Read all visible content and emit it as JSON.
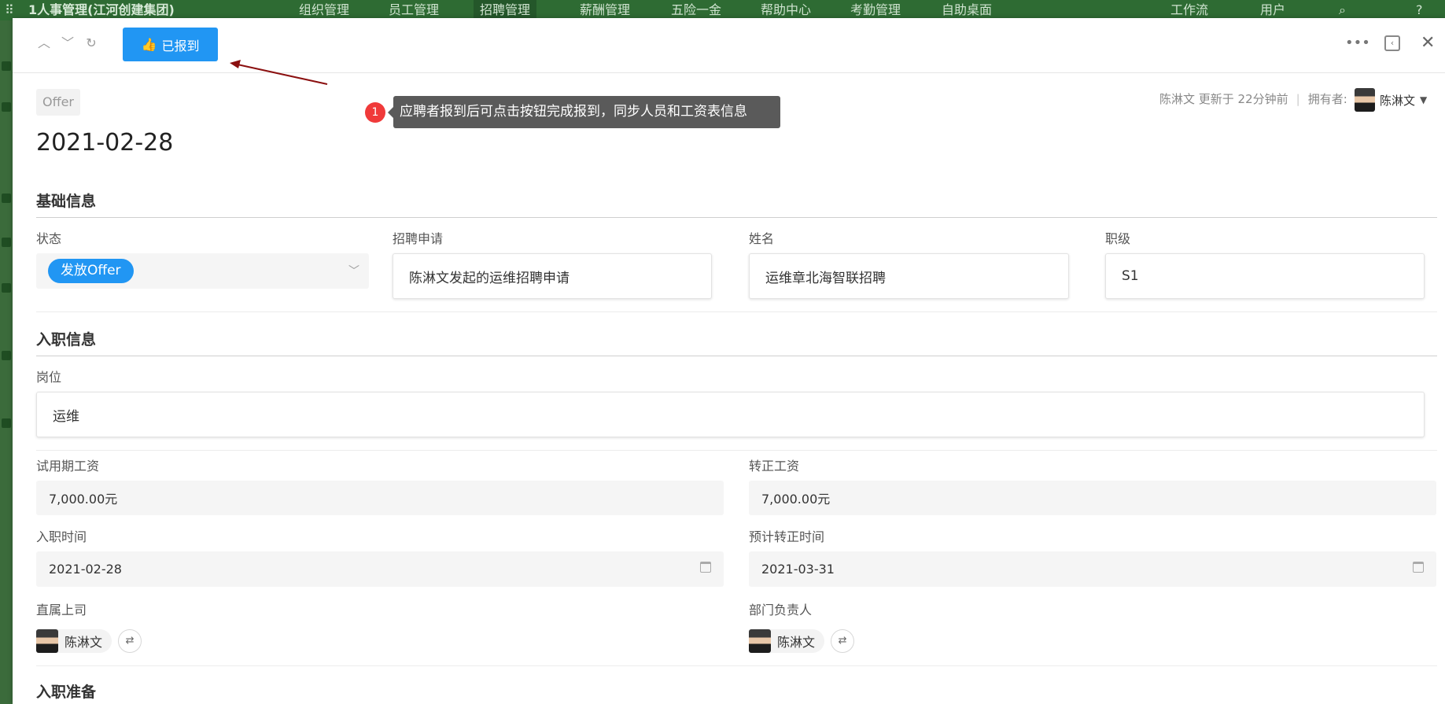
{
  "app": {
    "brand": "1人事管理(江河创建集团)",
    "nav": [
      "组织管理",
      "员工管理",
      "招聘管理",
      "薪酬管理",
      "五险一金",
      "帮助中心",
      "考勤管理",
      "自助桌面"
    ],
    "right_nav": [
      "工作流",
      "用户"
    ]
  },
  "toolbar": {
    "checkin_label": "已报到"
  },
  "tooltip": {
    "step": "1",
    "text": "应聘者报到后可点击按钮完成报到，同步人员和工资表信息"
  },
  "record": {
    "tag": "Offer",
    "title": "2021-02-28",
    "updated_by": "陈淋文 更新于 22分钟前",
    "owner_label": "拥有者:",
    "owner_name": "陈淋文"
  },
  "sections": {
    "basic": "基础信息",
    "onboard": "入职信息",
    "prepare": "入职准备"
  },
  "fields": {
    "status": {
      "label": "状态",
      "value": "发放Offer"
    },
    "application": {
      "label": "招聘申请",
      "value": "陈淋文发起的运维招聘申请"
    },
    "name": {
      "label": "姓名",
      "value": "运维章北海智联招聘"
    },
    "level": {
      "label": "职级",
      "value": "S1"
    },
    "position": {
      "label": "岗位",
      "value": "运维"
    },
    "probation_salary": {
      "label": "试用期工资",
      "value": "7,000.00元"
    },
    "regular_salary": {
      "label": "转正工资",
      "value": "7,000.00元"
    },
    "entry_date": {
      "label": "入职时间",
      "value": "2021-02-28"
    },
    "regular_date": {
      "label": "预计转正时间",
      "value": "2021-03-31"
    },
    "supervisor": {
      "label": "直属上司",
      "value": "陈淋文"
    },
    "dept_head": {
      "label": "部门负责人",
      "value": "陈淋文"
    }
  },
  "colors": {
    "primary": "#2196f3",
    "badge": "#f03a3a",
    "tooltip_bg": "#5a5a5a",
    "nav_bg": "#2e6b33"
  }
}
